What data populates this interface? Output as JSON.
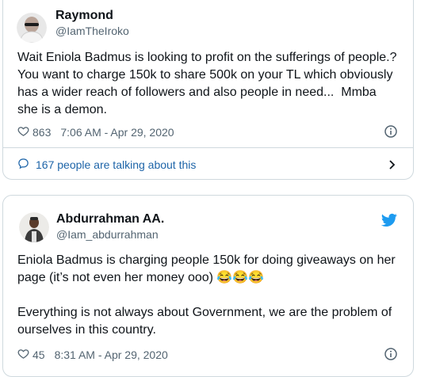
{
  "tweets": [
    {
      "name": "Raymond",
      "handle": "@IamTheIroko",
      "text": "Wait Eniola Badmus is looking to profit on the sufferings of people.? You want to charge 150k to share 500k on your TL which obviously has a wider reach of followers and also people in need...  Mmba she is a demon.",
      "likes": "863",
      "timestamp": "7:06 AM - Apr 29, 2020",
      "conversation": "167 people are talking about this"
    },
    {
      "name": "Abdurrahman AA.",
      "handle": "@Iam_abdurrahman",
      "text_line1": "Eniola Badmus is charging people 150k for doing giveaways on her page (it’s not even her money ooo) ",
      "emojis": "😂😂😂",
      "text_para2": "Everything is not always about Government, we are the problem of ourselves in this country.",
      "likes": "45",
      "timestamp": "8:31 AM - Apr 29, 2020"
    }
  ],
  "colors": {
    "link": "#1d64a8",
    "twitter_blue": "#1d9bf0",
    "muted": "#536471",
    "border": "#cfd9de"
  },
  "icons": {
    "like": "heart-icon",
    "info": "info-icon",
    "conversation": "speech-bubble-icon",
    "chevron": "chevron-right-icon",
    "brand": "twitter-bird-icon"
  }
}
